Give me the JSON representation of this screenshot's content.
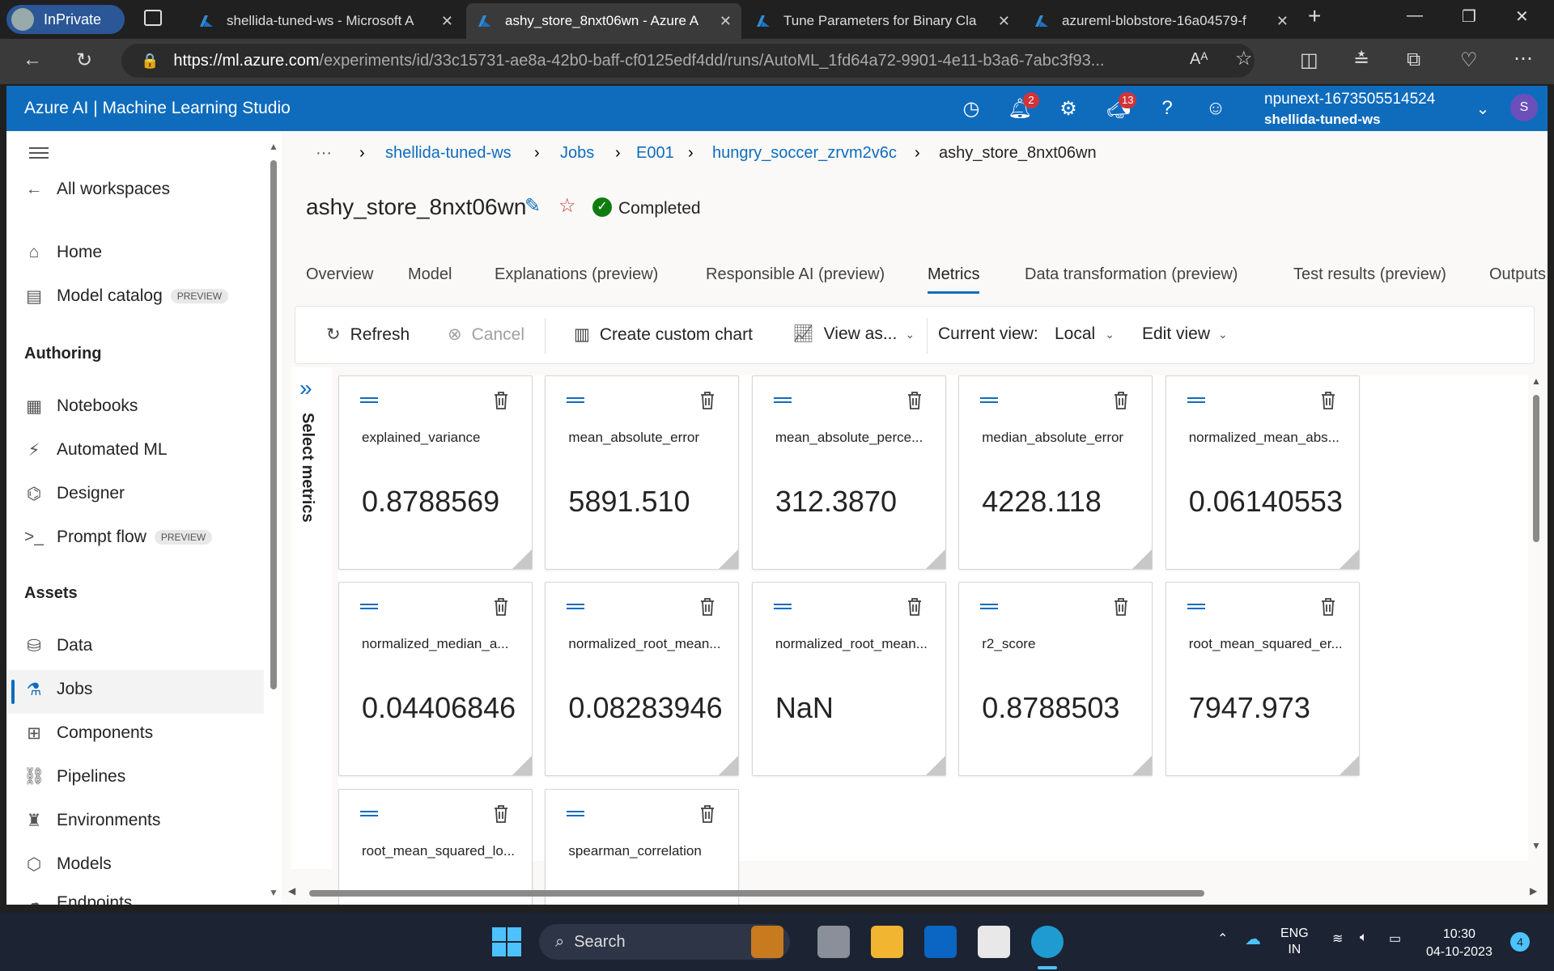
{
  "browser": {
    "profile": "InPrivate",
    "tabs": [
      {
        "title": "shellida-tuned-ws - Microsoft A"
      },
      {
        "title": "ashy_store_8nxt06wn - Azure A"
      },
      {
        "title": "Tune Parameters for Binary Cla"
      },
      {
        "title": "azureml-blobstore-16a04579-f"
      }
    ],
    "url_host": "https://ml.azure.com",
    "url_path": "/experiments/id/33c15731-ae8a-42b0-baff-cf0125edf4dd/runs/AutoML_1fd64a72-9901-4e11-b3a6-7abc3f93..."
  },
  "header": {
    "brand": "Azure AI | Machine Learning Studio",
    "notifications_count": "2",
    "announcements_count": "13",
    "workspace_line1": "npunext-1673505514524",
    "workspace_line2": "shellida-tuned-ws",
    "avatar_initial": "S"
  },
  "sidebar": {
    "all_workspaces": "All workspaces",
    "home": "Home",
    "model_catalog": "Model catalog",
    "preview_badge": "PREVIEW",
    "authoring_heading": "Authoring",
    "notebooks": "Notebooks",
    "automated_ml": "Automated ML",
    "designer": "Designer",
    "prompt_flow": "Prompt flow",
    "assets_heading": "Assets",
    "data": "Data",
    "jobs": "Jobs",
    "components": "Components",
    "pipelines": "Pipelines",
    "environments": "Environments",
    "models": "Models",
    "endpoints": "Endpoints"
  },
  "breadcrumb": {
    "ellipsis": "···",
    "items": [
      "shellida-tuned-ws",
      "Jobs",
      "E001",
      "hungry_soccer_zrvm2v6c",
      "ashy_store_8nxt06wn"
    ]
  },
  "page": {
    "title": "ashy_store_8nxt06wn",
    "status": "Completed"
  },
  "tabs": [
    "Overview",
    "Model",
    "Explanations (preview)",
    "Responsible AI (preview)",
    "Metrics",
    "Data transformation (preview)",
    "Test results (preview)",
    "Outputs"
  ],
  "toolbar": {
    "refresh": "Refresh",
    "cancel": "Cancel",
    "create_chart": "Create custom chart",
    "view_as": "View as...",
    "current_view_label": "Current view:",
    "current_view_value": "Local",
    "edit_view": "Edit view"
  },
  "select_metrics": "Select metrics",
  "metrics": [
    {
      "name": "explained_variance",
      "value": "0.8788569"
    },
    {
      "name": "mean_absolute_error",
      "value": "5891.510"
    },
    {
      "name": "mean_absolute_perce...",
      "value": "312.3870"
    },
    {
      "name": "median_absolute_error",
      "value": "4228.118"
    },
    {
      "name": "normalized_mean_abs...",
      "value": "0.06140553"
    },
    {
      "name": "normalized_median_a...",
      "value": "0.04406846"
    },
    {
      "name": "normalized_root_mean...",
      "value": "0.08283946"
    },
    {
      "name": "normalized_root_mean...",
      "value": "NaN"
    },
    {
      "name": "r2_score",
      "value": "0.8788503"
    },
    {
      "name": "root_mean_squared_er...",
      "value": "7947.973"
    },
    {
      "name": "root_mean_squared_lo...",
      "value": ""
    },
    {
      "name": "spearman_correlation",
      "value": ""
    }
  ],
  "taskbar": {
    "search": "Search",
    "lang1": "ENG",
    "lang2": "IN",
    "time": "10:30",
    "date": "04-10-2023",
    "notif_count": "4"
  },
  "colors": {
    "accent": "#0f6cbd",
    "success": "#107c10",
    "badge": "#d13438"
  }
}
